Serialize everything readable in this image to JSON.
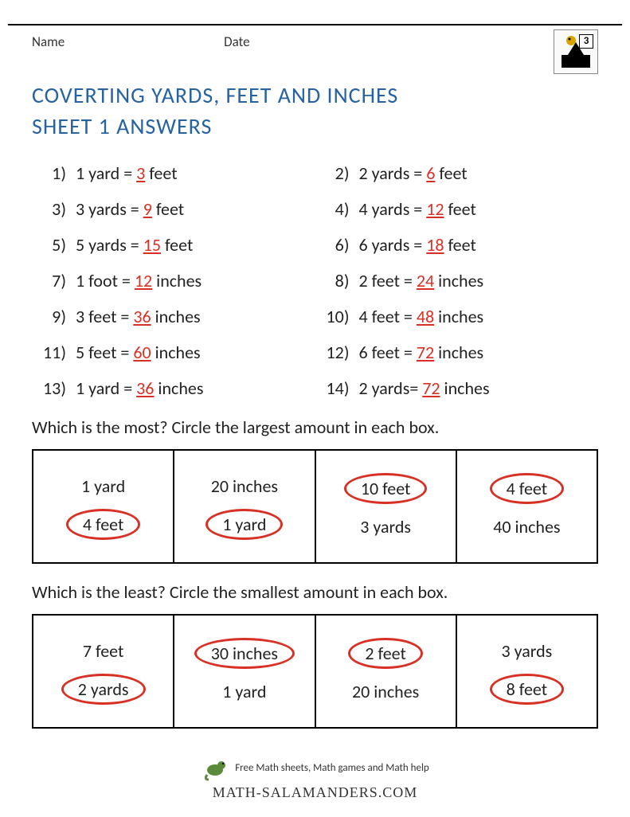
{
  "header": {
    "name_label": "Name",
    "date_label": "Date",
    "grade_badge": "3"
  },
  "title_line1": "COVERTING YARDS, FEET AND INCHES",
  "title_line2": "SHEET 1 ANSWERS",
  "problems": [
    {
      "n": "1)",
      "lhs": "1 yard = ",
      "ans": "3",
      "rhs": " feet"
    },
    {
      "n": "2)",
      "lhs": "2 yards = ",
      "ans": "6",
      "rhs": " feet"
    },
    {
      "n": "3)",
      "lhs": "3 yards = ",
      "ans": "9",
      "rhs": " feet"
    },
    {
      "n": "4)",
      "lhs": "4 yards = ",
      "ans": "12",
      "rhs": " feet"
    },
    {
      "n": "5)",
      "lhs": "5 yards = ",
      "ans": "15",
      "rhs": " feet"
    },
    {
      "n": "6)",
      "lhs": "6 yards = ",
      "ans": "18",
      "rhs": " feet"
    },
    {
      "n": "7)",
      "lhs": "1 foot = ",
      "ans": "12",
      "rhs": " inches"
    },
    {
      "n": "8)",
      "lhs": "2 feet = ",
      "ans": "24",
      "rhs": " inches"
    },
    {
      "n": "9)",
      "lhs": "3 feet = ",
      "ans": "36",
      "rhs": " inches"
    },
    {
      "n": "10)",
      "lhs": "4 feet = ",
      "ans": "48",
      "rhs": " inches"
    },
    {
      "n": "11)",
      "lhs": "5 feet = ",
      "ans": "60",
      "rhs": " inches"
    },
    {
      "n": "12)",
      "lhs": "6 feet = ",
      "ans": "72",
      "rhs": " inches"
    },
    {
      "n": "13)",
      "lhs": "1 yard = ",
      "ans": "36",
      "rhs": " inches"
    },
    {
      "n": "14)",
      "lhs": "2 yards= ",
      "ans": "72",
      "rhs": " inches"
    }
  ],
  "most_question": "Which is the most? Circle the largest amount in each box.",
  "most_boxes": [
    {
      "a": "1 yard",
      "b": "4 feet",
      "circled": "b"
    },
    {
      "a": "20 inches",
      "b": "1 yard",
      "circled": "b"
    },
    {
      "a": "10 feet",
      "b": "3 yards",
      "circled": "a"
    },
    {
      "a": "4 feet",
      "b": "40 inches",
      "circled": "a"
    }
  ],
  "least_question": "Which is the least? Circle the smallest amount in each box.",
  "least_boxes": [
    {
      "a": "7 feet",
      "b": "2 yards",
      "circled": "b"
    },
    {
      "a": "30 inches",
      "b": "1 yard",
      "circled": "a"
    },
    {
      "a": "2 feet",
      "b": "20 inches",
      "circled": "a"
    },
    {
      "a": "3 yards",
      "b": "8 feet",
      "circled": "b"
    }
  ],
  "footer": {
    "tagline": "Free Math sheets, Math games and Math help",
    "brand": "MATH-SALAMANDERS.COM"
  }
}
